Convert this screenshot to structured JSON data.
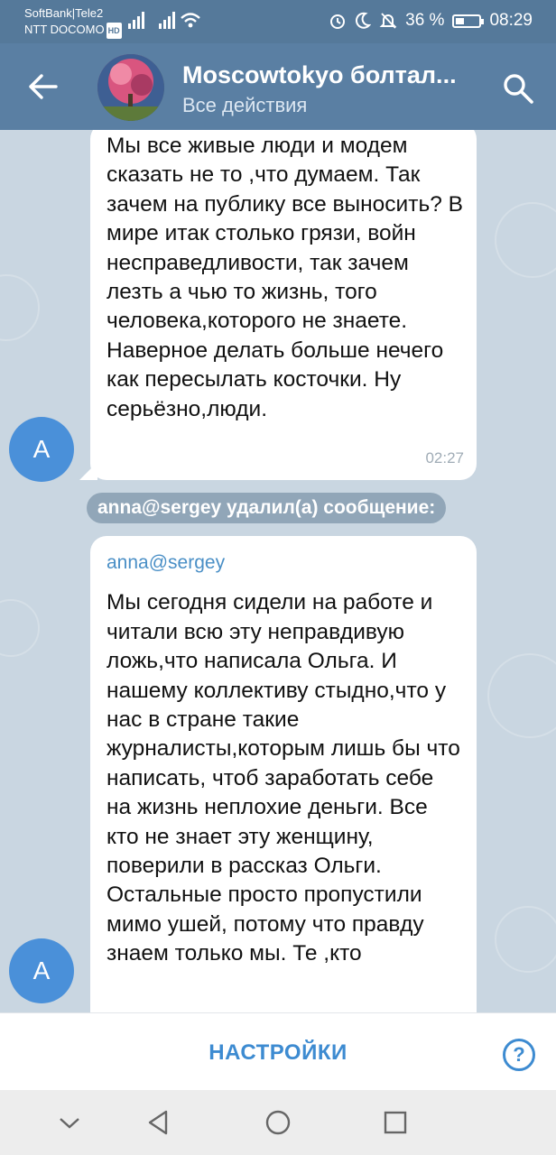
{
  "status_bar": {
    "carrier_line1": "SoftBank|Tele2",
    "carrier_line2": "NTT DOCOMO",
    "hd": "HD",
    "battery_percent": "36 %",
    "battery_level": 0.36,
    "time": "08:29"
  },
  "header": {
    "title": "Moscowtokyo болтал...",
    "subtitle": "Все действия"
  },
  "messages": [
    {
      "avatar_letter": "A",
      "text": "Мы все живые люди и модем сказать не то ,что думаем. Так зачем на публику все выносить? В мире итак столько грязи, войн несправедливости, так зачем лезть а чью то жизнь, того человека,которого не знаете. Наверное делать больше нечего как пересылать косточки. Ну серьёзно,люди.",
      "time": "02:27"
    },
    {
      "avatar_letter": "A",
      "sender": "anna@sergey",
      "text": "Мы сегодня сидели на работе и читали всю эту неправдивую ложь,что написала Ольга. И нашему коллективу стыдно,что у нас в стране такие журналисты,которым лишь бы что написать, чтоб заработать себе на жизнь неплохие деньги. Все кто не знает эту женщину, поверили в рассказ Ольги. Остальные просто пропустили мимо ушей, потому что правду знаем только мы. Те ,кто"
    }
  ],
  "service_message": "anna@sergey удалил(а) сообщение:",
  "bottom_bar": {
    "settings_label": "НАСТРОЙКИ",
    "help_glyph": "?"
  },
  "icons": {
    "back": "arrow-left-icon",
    "search": "search-icon",
    "help": "help-circle-icon",
    "nav": [
      "collapse-icon",
      "back-triangle-icon",
      "home-circle-icon",
      "recents-square-icon"
    ]
  },
  "colors": {
    "status_bar": "#55799a",
    "header": "#5a7fa3",
    "chat_bg": "#c9d6e1",
    "accent": "#3d8bd1",
    "avatar": "#4a90d9"
  }
}
